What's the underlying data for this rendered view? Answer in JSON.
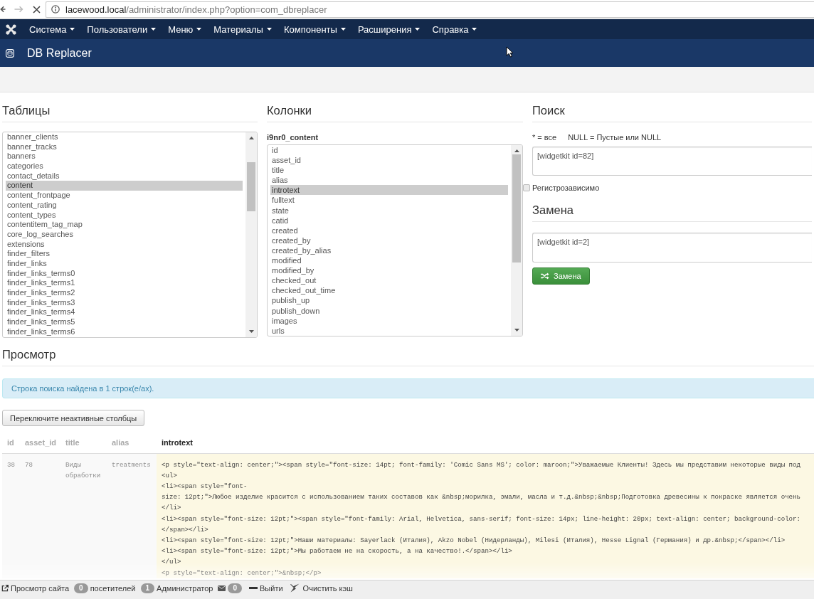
{
  "browser": {
    "url": {
      "host": "lacewood.local",
      "path": "/administrator/index.php?option=com_dbreplacer"
    }
  },
  "navbar": {
    "menus": [
      {
        "label": "Система"
      },
      {
        "label": "Пользователи"
      },
      {
        "label": "Меню"
      },
      {
        "label": "Материалы"
      },
      {
        "label": "Компоненты"
      },
      {
        "label": "Расширения"
      },
      {
        "label": "Справка"
      }
    ]
  },
  "header": {
    "title": "DB Replacer"
  },
  "tables": {
    "heading": "Таблицы",
    "items": [
      {
        "label": "banner_clients",
        "selected": false
      },
      {
        "label": "banner_tracks",
        "selected": false
      },
      {
        "label": "banners",
        "selected": false
      },
      {
        "label": "categories",
        "selected": false
      },
      {
        "label": "contact_details",
        "selected": false
      },
      {
        "label": "content",
        "selected": true
      },
      {
        "label": "content_frontpage",
        "selected": false
      },
      {
        "label": "content_rating",
        "selected": false
      },
      {
        "label": "content_types",
        "selected": false
      },
      {
        "label": "contentitem_tag_map",
        "selected": false
      },
      {
        "label": "core_log_searches",
        "selected": false
      },
      {
        "label": "extensions",
        "selected": false
      },
      {
        "label": "finder_filters",
        "selected": false
      },
      {
        "label": "finder_links",
        "selected": false
      },
      {
        "label": "finder_links_terms0",
        "selected": false
      },
      {
        "label": "finder_links_terms1",
        "selected": false
      },
      {
        "label": "finder_links_terms2",
        "selected": false
      },
      {
        "label": "finder_links_terms3",
        "selected": false
      },
      {
        "label": "finder_links_terms4",
        "selected": false
      },
      {
        "label": "finder_links_terms5",
        "selected": false
      },
      {
        "label": "finder_links_terms6",
        "selected": false
      }
    ]
  },
  "columns": {
    "heading": "Колонки",
    "table_name": "i9nr0_content",
    "items": [
      {
        "label": "id",
        "selected": false
      },
      {
        "label": "asset_id",
        "selected": false
      },
      {
        "label": "title",
        "selected": false
      },
      {
        "label": "alias",
        "selected": false
      },
      {
        "label": "introtext",
        "selected": true
      },
      {
        "label": "fulltext",
        "selected": false
      },
      {
        "label": "state",
        "selected": false
      },
      {
        "label": "catid",
        "selected": false
      },
      {
        "label": "created",
        "selected": false
      },
      {
        "label": "created_by",
        "selected": false
      },
      {
        "label": "created_by_alias",
        "selected": false
      },
      {
        "label": "modified",
        "selected": false
      },
      {
        "label": "modified_by",
        "selected": false
      },
      {
        "label": "checked_out",
        "selected": false
      },
      {
        "label": "checked_out_time",
        "selected": false
      },
      {
        "label": "publish_up",
        "selected": false
      },
      {
        "label": "publish_down",
        "selected": false
      },
      {
        "label": "images",
        "selected": false
      },
      {
        "label": "urls",
        "selected": false
      }
    ]
  },
  "search": {
    "heading": "Поиск",
    "hints": [
      "* = все",
      "NULL = Пустые или NULL"
    ],
    "value": "[widgetkit id=82]",
    "case_sensitive": {
      "label": "Регистрозависимо",
      "checked": false
    }
  },
  "replace": {
    "heading": "Замена",
    "value": "[widgetkit id=2]",
    "button": "Замена"
  },
  "preview": {
    "heading": "Просмотр",
    "alert": "Строка поиска найдена в 1 строк(е/ах).",
    "toggle_button": "Переключите неактивные столбцы",
    "columns": [
      {
        "label": "id",
        "active": false
      },
      {
        "label": "asset_id",
        "active": false
      },
      {
        "label": "title",
        "active": false
      },
      {
        "label": "alias",
        "active": false
      },
      {
        "label": "introtext",
        "active": true
      }
    ],
    "rows": [
      {
        "cells": [
          "38",
          "78",
          "Виды обработки",
          "treatments",
          "<p style=\"text-align: center;\"><span style=\"font-size: 14pt; font-family: 'Comic Sans MS'; color: maroon;\">Уважаемые Клиенты! Здесь мы представим некоторые виды под\n<ul>\n<li><span style=\"font-\nsize: 12pt;\">Любое изделие красится с использованием таких составов как &nbsp;морилка, эмали, масла и т.д.&nbsp;&nbsp;Подготовка древесины к покраске является очень\n</li>\n<li><span style=\"font-size: 12pt;\"><span style=\"font-family: Arial, Helvetica, sans-serif; font-size: 14px; line-height: 20px; text-align: center; background-color:\n</span></li>\n<li><span style=\"font-size: 12pt;\">Наши материалы: Sayerlack (Италия), Akzo Nobel (Нидерланды), Milesi (Италия), Hesse Lignal (Германия) и др.&nbsp;</span></li>\n<li><span style=\"font-size: 12pt;\">Мы работаем не на скорость, а на качество!.</span></li>\n</ul>\n<p style=\"text-align: center;\">&nbsp;</p>"
        ]
      }
    ]
  },
  "status_bar": {
    "items": [
      {
        "kind": "site_link",
        "label": "Просмотр сайта"
      },
      {
        "kind": "counter",
        "count": "0",
        "label": "посетителей"
      },
      {
        "kind": "counter",
        "count": "1",
        "label": "Администратор"
      },
      {
        "kind": "messages",
        "count": "0"
      },
      {
        "kind": "logout",
        "label": "Выйти"
      },
      {
        "kind": "cache",
        "label": "Очистить кэш"
      }
    ]
  }
}
